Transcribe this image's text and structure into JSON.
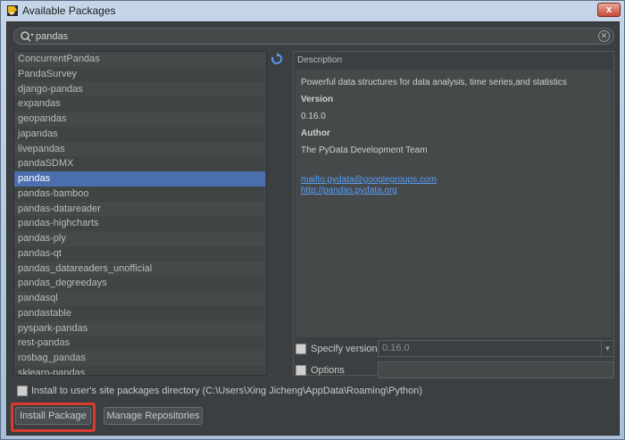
{
  "window": {
    "title": "Available Packages",
    "close_label": "x"
  },
  "search": {
    "value": "pandas"
  },
  "packages": [
    "ConcurrentPandas",
    "PandaSurvey",
    "django-pandas",
    "expandas",
    "geopandas",
    "japandas",
    "livepandas",
    "pandaSDMX",
    "pandas",
    "pandas-bamboo",
    "pandas-datareader",
    "pandas-highcharts",
    "pandas-ply",
    "pandas-qt",
    "pandas_datareaders_unofficial",
    "pandas_degreedays",
    "pandasql",
    "pandastable",
    "pyspark-pandas",
    "rest-pandas",
    "rosbag_pandas",
    "sklearn-pandas"
  ],
  "selected_package": "pandas",
  "description": {
    "label": "Description",
    "summary": "Powerful data structures for data analysis, time series,and statistics",
    "version_heading": "Version",
    "version": "0.16.0",
    "author_heading": "Author",
    "author": "The PyData Development Team",
    "email_link": "mailto:pydata@googlegroups.com",
    "homepage_link": "http://pandas.pydata.org"
  },
  "specify_version": {
    "label": "Specify version",
    "value": "0.16.0"
  },
  "options": {
    "label": "Options",
    "value": ""
  },
  "install_to_user": {
    "label": "Install to user's site packages directory (C:\\Users\\Xing Jicheng\\AppData\\Roaming\\Python)"
  },
  "buttons": {
    "install": "Install Package",
    "manage": "Manage Repositories"
  },
  "colors": {
    "accent_selected": "#4b6eaf",
    "highlight_box": "#d93a2b",
    "link": "#589df6",
    "background": "#3c3f41"
  },
  "icons": {
    "app": "pycharm-app-icon",
    "search": "search-icon",
    "clear": "clear-icon",
    "refresh": "refresh-icon"
  }
}
